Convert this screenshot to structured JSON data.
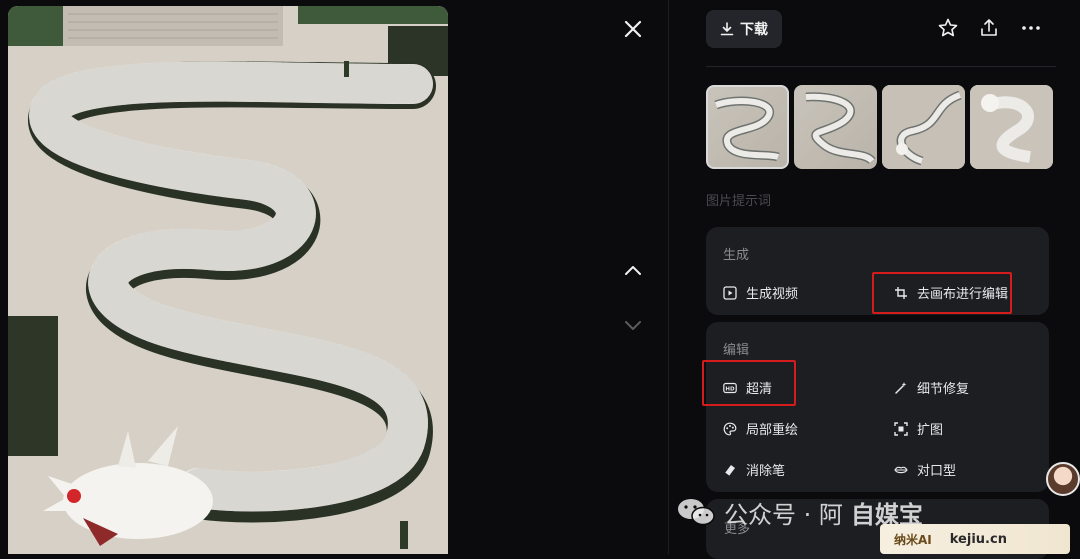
{
  "toolbar": {
    "download_label": "下载",
    "icons": [
      "download-icon",
      "star-icon",
      "share-icon",
      "more-icon"
    ]
  },
  "navigation": {
    "icons": [
      "close-icon",
      "chevron-up-icon",
      "chevron-down-icon"
    ]
  },
  "thumbnails": {
    "count": 4,
    "selected_index": 0
  },
  "prompt_section_label": "图片提示词",
  "generate_card": {
    "title": "生成",
    "items": [
      {
        "label": "生成视频",
        "icon": "play-icon"
      },
      {
        "label": "去画布进行编辑",
        "icon": "crop-icon"
      }
    ]
  },
  "edit_card": {
    "title": "编辑",
    "items": [
      {
        "label": "超清",
        "icon": "hd-icon"
      },
      {
        "label": "细节修复",
        "icon": "magic-wand-icon"
      },
      {
        "label": "局部重绘",
        "icon": "palette-icon"
      },
      {
        "label": "扩图",
        "icon": "expand-icon"
      },
      {
        "label": "消除笔",
        "icon": "eraser-icon"
      },
      {
        "label": "对口型",
        "icon": "lips-icon"
      }
    ]
  },
  "more_card": {
    "title": "更多"
  },
  "watermark": {
    "text": "公众号 · 阿",
    "text_tail": "自媒宝",
    "site": "kejiu.cn",
    "logo_text": "纳米AI"
  },
  "colors": {
    "background": "#0b0b0d",
    "card": "#1d1e22",
    "button": "#24252a",
    "highlight_box": "#d51c1c"
  }
}
